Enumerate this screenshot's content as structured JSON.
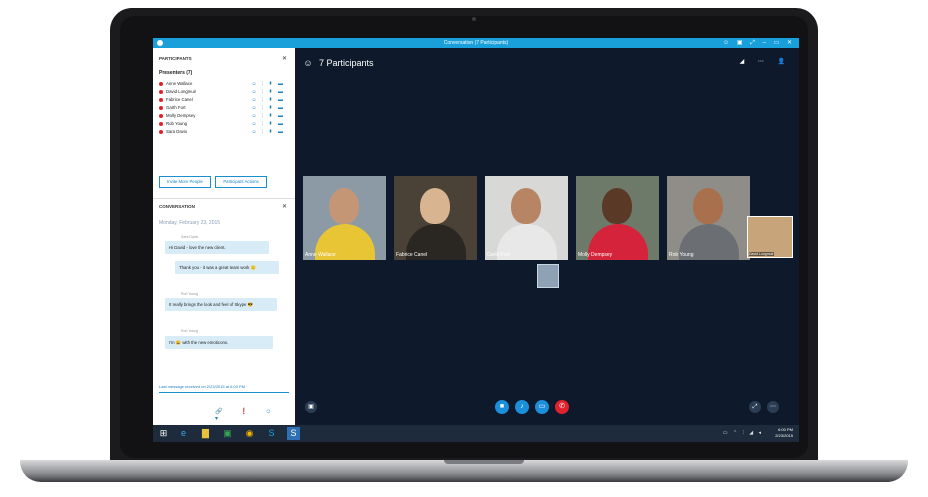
{
  "window": {
    "title": "Conversation (7 Participants)",
    "controls": "☺ ▣ ⤢ – ▭ ✕"
  },
  "participants_pane": {
    "header": "PARTICIPANTS",
    "close": "✕",
    "presenters_label": "Presenters (7)",
    "people": [
      {
        "name": "Anne Wallace"
      },
      {
        "name": "David Longmuir"
      },
      {
        "name": "Fabrice Canel"
      },
      {
        "name": "Garth Fort"
      },
      {
        "name": "Molly Dempsey"
      },
      {
        "name": "Rob Young"
      },
      {
        "name": "Sara Davis"
      }
    ],
    "person_icons": "☺ ⫶ ▮ ▬",
    "invite_button": "Invite More People",
    "actions_button": "Participant Actions"
  },
  "conversation": {
    "header": "CONVERSATION",
    "close": "✕",
    "date": "Monday, February 23, 2015",
    "messages": [
      {
        "sender": "Sara Davis",
        "text": "Hi David - love the new client."
      },
      {
        "sender": "",
        "text": "Thank you - it was a great team work 🙂"
      },
      {
        "sender": "Rob Young",
        "text": "It really brings the look and feel of Skype 😎"
      },
      {
        "sender": "Rob Young",
        "text": "I'm 😀 with the new emoticons."
      }
    ],
    "last_message": "Last message received on 2/23/2015 at 6:00 PM",
    "tools": [
      "🔗",
      "❗",
      "☺",
      "▾"
    ]
  },
  "stage": {
    "participants_count": "7 Participants",
    "header_icons": "◢ ⋯",
    "add_person_icon": "👤",
    "tiles": [
      {
        "name": "Anne Wallace"
      },
      {
        "name": "Fabrice Canel"
      },
      {
        "name": "Garth Fort"
      },
      {
        "name": "Molly Dempsey"
      },
      {
        "name": "Rob Young"
      }
    ],
    "small_tile": {
      "name": "David Longmuir"
    },
    "controls": {
      "chat": "▣",
      "video": "■",
      "mic": "♪",
      "screen": "▭",
      "hangup": "✆",
      "popout": "⤢",
      "more": "⋯"
    }
  },
  "taskbar": {
    "start_icon": "⊞",
    "apps": [
      "e",
      "▇",
      "▣",
      "◉",
      "S",
      "S"
    ],
    "tray_icons": "▭ ⌃ ⫶ ◢ ◂",
    "time": "6:00 PM",
    "date": "2/23/2015"
  }
}
